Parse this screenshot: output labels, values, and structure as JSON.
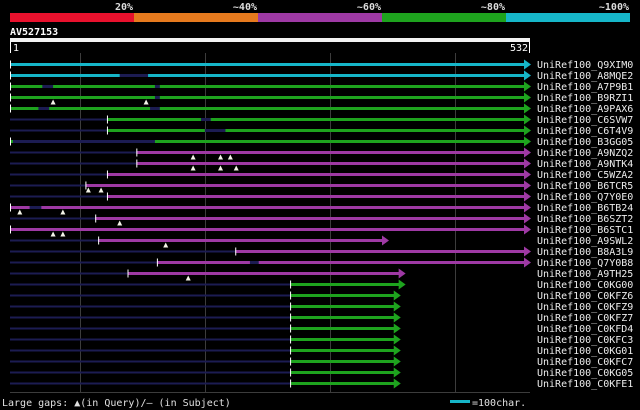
{
  "identity_legend": [
    {
      "label": "20%",
      "color": "#e8112d"
    },
    {
      "label": "~40%",
      "color": "#e67a1e"
    },
    {
      "label": "~60%",
      "color": "#9e39a4"
    },
    {
      "label": "~80%",
      "color": "#1ea31e"
    },
    {
      "label": "~100%",
      "color": "#16b6c9"
    }
  ],
  "query": {
    "id": "AV527153",
    "start": 1,
    "length": 532
  },
  "hits": [
    {
      "id": "UniRef100_Q9XIM0",
      "color": "#16b6c9",
      "start": 1,
      "end": 532,
      "query_gaps": [],
      "subject_gaps": []
    },
    {
      "id": "UniRef100_A8MQE2",
      "color": "#16b6c9",
      "start": 1,
      "end": 532,
      "query_gaps": [],
      "subject_gaps": [
        [
          113,
          142
        ]
      ]
    },
    {
      "id": "UniRef100_A7P9B1",
      "color": "#1ea31e",
      "start": 1,
      "end": 532,
      "query_gaps": [],
      "subject_gaps": [
        [
          34,
          45
        ],
        [
          149,
          154
        ]
      ]
    },
    {
      "id": "UniRef100_B9RZI1",
      "color": "#1ea31e",
      "start": 1,
      "end": 532,
      "query_gaps": [
        45,
        140
      ],
      "subject_gaps": [
        [
          149,
          154
        ]
      ]
    },
    {
      "id": "UniRef100_A9PAX6",
      "color": "#1ea31e",
      "start": 1,
      "end": 532,
      "query_gaps": [],
      "subject_gaps": [
        [
          30,
          41
        ],
        [
          144,
          154
        ]
      ]
    },
    {
      "id": "UniRef100_C6SVW7",
      "color": "#1ea31e",
      "start": 100,
      "end": 532,
      "query_gaps": [],
      "subject_gaps": [
        [
          196,
          206
        ]
      ]
    },
    {
      "id": "UniRef100_C6T4V9",
      "color": "#1ea31e",
      "start": 100,
      "end": 532,
      "query_gaps": [],
      "subject_gaps": [
        [
          200,
          221
        ]
      ]
    },
    {
      "id": "UniRef100_B3GG05",
      "color": "#1ea31e",
      "start": 1,
      "end": 532,
      "query_gaps": [],
      "subject_gaps": [
        [
          4,
          149
        ]
      ]
    },
    {
      "id": "UniRef100_A9NZQ2",
      "color": "#9e39a4",
      "start": 130,
      "end": 532,
      "query_gaps": [
        188,
        216,
        226
      ],
      "subject_gaps": []
    },
    {
      "id": "UniRef100_A9NTK4",
      "color": "#9e39a4",
      "start": 130,
      "end": 532,
      "query_gaps": [
        188,
        216,
        232
      ],
      "subject_gaps": []
    },
    {
      "id": "UniRef100_C5WZA2",
      "color": "#9e39a4",
      "start": 100,
      "end": 532,
      "query_gaps": [],
      "subject_gaps": []
    },
    {
      "id": "UniRef100_B6TCR5",
      "color": "#9e39a4",
      "start": 78,
      "end": 532,
      "query_gaps": [
        81,
        94
      ],
      "subject_gaps": []
    },
    {
      "id": "UniRef100_Q7Y0E0",
      "color": "#9e39a4",
      "start": 100,
      "end": 532,
      "query_gaps": [],
      "subject_gaps": []
    },
    {
      "id": "UniRef100_B6TB24",
      "color": "#9e39a4",
      "start": 1,
      "end": 532,
      "query_gaps": [
        11,
        55
      ],
      "subject_gaps": [
        [
          21,
          33
        ]
      ]
    },
    {
      "id": "UniRef100_B6SZT2",
      "color": "#9e39a4",
      "start": 88,
      "end": 532,
      "query_gaps": [
        113
      ],
      "subject_gaps": []
    },
    {
      "id": "UniRef100_B6STC1",
      "color": "#9e39a4",
      "start": 1,
      "end": 532,
      "query_gaps": [
        45,
        55
      ],
      "subject_gaps": []
    },
    {
      "id": "UniRef100_A9SWL2",
      "color": "#9e39a4",
      "start": 91,
      "end": 387,
      "query_gaps": [
        160
      ],
      "subject_gaps": []
    },
    {
      "id": "UniRef100_B8A3L9",
      "color": "#9e39a4",
      "start": 231,
      "end": 532,
      "query_gaps": [],
      "subject_gaps": []
    },
    {
      "id": "UniRef100_Q7Y0B8",
      "color": "#9e39a4",
      "start": 151,
      "end": 532,
      "query_gaps": [],
      "subject_gaps": [
        [
          246,
          255
        ]
      ]
    },
    {
      "id": "UniRef100_A9TH25",
      "color": "#9e39a4",
      "start": 121,
      "end": 404,
      "query_gaps": [
        183
      ],
      "subject_gaps": []
    },
    {
      "id": "UniRef100_C0KG00",
      "color": "#1ea31e",
      "start": 287,
      "end": 404,
      "query_gaps": [],
      "subject_gaps": []
    },
    {
      "id": "UniRef100_C0KFZ6",
      "color": "#1ea31e",
      "start": 287,
      "end": 399,
      "query_gaps": [],
      "subject_gaps": []
    },
    {
      "id": "UniRef100_C0KFZ9",
      "color": "#1ea31e",
      "start": 287,
      "end": 399,
      "query_gaps": [],
      "subject_gaps": []
    },
    {
      "id": "UniRef100_C0KFZ7",
      "color": "#1ea31e",
      "start": 287,
      "end": 399,
      "query_gaps": [],
      "subject_gaps": []
    },
    {
      "id": "UniRef100_C0KFD4",
      "color": "#1ea31e",
      "start": 287,
      "end": 399,
      "query_gaps": [],
      "subject_gaps": []
    },
    {
      "id": "UniRef100_C0KFC3",
      "color": "#1ea31e",
      "start": 287,
      "end": 399,
      "query_gaps": [],
      "subject_gaps": []
    },
    {
      "id": "UniRef100_C0KG01",
      "color": "#1ea31e",
      "start": 287,
      "end": 399,
      "query_gaps": [],
      "subject_gaps": []
    },
    {
      "id": "UniRef100_C0KFC7",
      "color": "#1ea31e",
      "start": 287,
      "end": 399,
      "query_gaps": [],
      "subject_gaps": []
    },
    {
      "id": "UniRef100_C0KG05",
      "color": "#1ea31e",
      "start": 287,
      "end": 399,
      "query_gaps": [],
      "subject_gaps": []
    },
    {
      "id": "UniRef100_C0KFE1",
      "color": "#1ea31e",
      "start": 287,
      "end": 399,
      "query_gaps": [],
      "subject_gaps": []
    }
  ],
  "footer": {
    "gaps_label": "Large gaps: ▲(in Query)/– (in Subject)",
    "scale_label": "=100char.",
    "scale_color": "#16b6c9"
  }
}
